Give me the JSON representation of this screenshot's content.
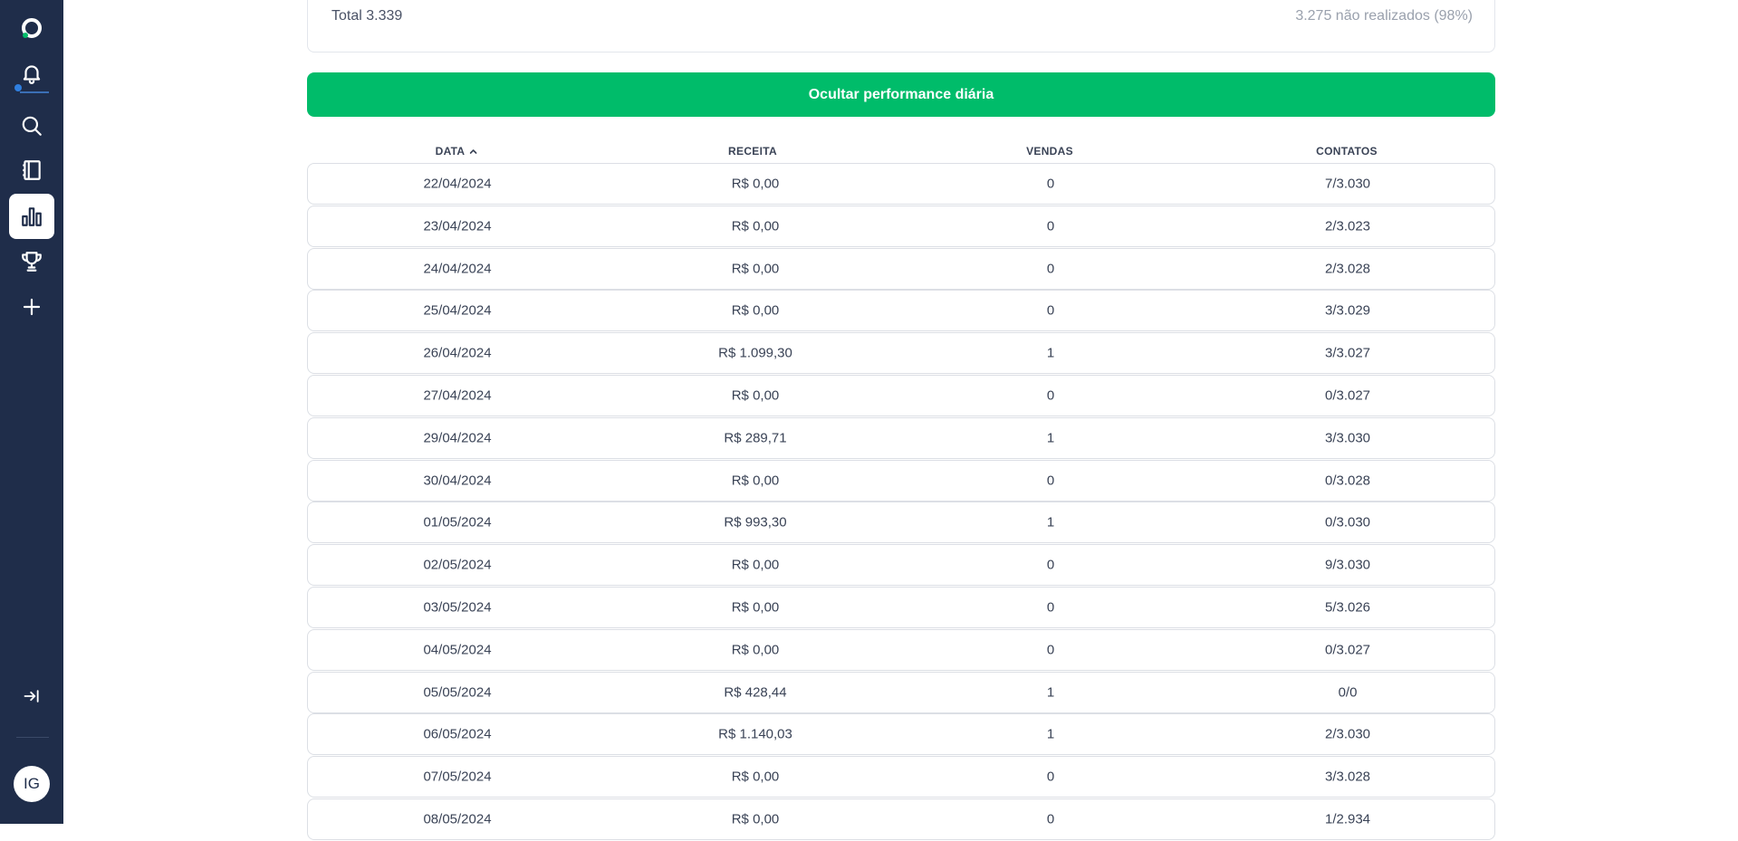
{
  "sidebar": {
    "items": [
      {
        "icon": "logo-icon"
      },
      {
        "icon": "bell-icon"
      },
      {
        "icon": "search-icon"
      },
      {
        "icon": "notebook-icon"
      },
      {
        "icon": "bar-chart-icon",
        "active": true
      },
      {
        "icon": "trophy-icon"
      },
      {
        "icon": "plus-icon"
      },
      {
        "icon": "collapse-arrow-icon"
      }
    ],
    "avatar_initials": "IG"
  },
  "summary": {
    "total": "Total 3.339",
    "unrealized": "3.275 não realizados (98%)"
  },
  "toggle_button": {
    "label": "Ocultar performance diária",
    "color": "#00bc6a"
  },
  "table": {
    "headers": {
      "date": "DATA",
      "revenue": "RECEITA",
      "sales": "VENDAS",
      "contacts": "CONTATOS"
    },
    "sort": {
      "column": "date",
      "direction": "ascending",
      "icon": "chevron-up-icon"
    },
    "rows": [
      {
        "date": "22/04/2024",
        "revenue": "R$ 0,00",
        "sales": "0",
        "contacts": "7/3.030"
      },
      {
        "date": "23/04/2024",
        "revenue": "R$ 0,00",
        "sales": "0",
        "contacts": "2/3.023"
      },
      {
        "date": "24/04/2024",
        "revenue": "R$ 0,00",
        "sales": "0",
        "contacts": "2/3.028"
      },
      {
        "date": "25/04/2024",
        "revenue": "R$ 0,00",
        "sales": "0",
        "contacts": "3/3.029"
      },
      {
        "date": "26/04/2024",
        "revenue": "R$ 1.099,30",
        "sales": "1",
        "contacts": "3/3.027"
      },
      {
        "date": "27/04/2024",
        "revenue": "R$ 0,00",
        "sales": "0",
        "contacts": "0/3.027"
      },
      {
        "date": "29/04/2024",
        "revenue": "R$ 289,71",
        "sales": "1",
        "contacts": "3/3.030"
      },
      {
        "date": "30/04/2024",
        "revenue": "R$ 0,00",
        "sales": "0",
        "contacts": "0/3.028"
      },
      {
        "date": "01/05/2024",
        "revenue": "R$ 993,30",
        "sales": "1",
        "contacts": "0/3.030"
      },
      {
        "date": "02/05/2024",
        "revenue": "R$ 0,00",
        "sales": "0",
        "contacts": "9/3.030"
      },
      {
        "date": "03/05/2024",
        "revenue": "R$ 0,00",
        "sales": "0",
        "contacts": "5/3.026"
      },
      {
        "date": "04/05/2024",
        "revenue": "R$ 0,00",
        "sales": "0",
        "contacts": "0/3.027"
      },
      {
        "date": "05/05/2024",
        "revenue": "R$ 428,44",
        "sales": "1",
        "contacts": "0/0"
      },
      {
        "date": "06/05/2024",
        "revenue": "R$ 1.140,03",
        "sales": "1",
        "contacts": "2/3.030"
      },
      {
        "date": "07/05/2024",
        "revenue": "R$ 0,00",
        "sales": "0",
        "contacts": "3/3.028"
      },
      {
        "date": "08/05/2024",
        "revenue": "R$ 0,00",
        "sales": "0",
        "contacts": "1/2.934"
      }
    ]
  }
}
